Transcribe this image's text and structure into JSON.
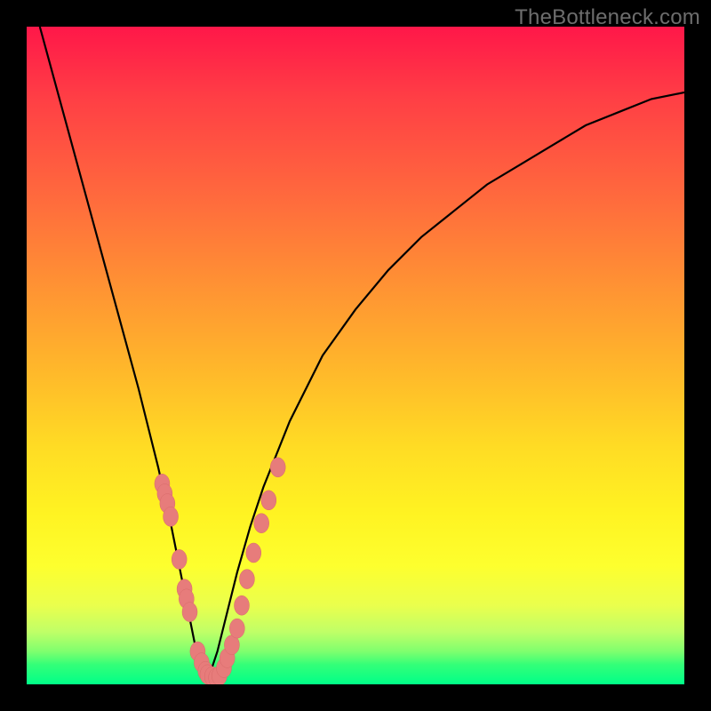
{
  "watermark": "TheBottleneck.com",
  "colors": {
    "frame": "#000000",
    "curve": "#000000",
    "marker_fill": "#e77c7b",
    "marker_stroke": "#d86a69"
  },
  "chart_data": {
    "type": "line",
    "title": "",
    "xlabel": "",
    "ylabel": "",
    "xlim": [
      0,
      100
    ],
    "ylim": [
      0,
      100
    ],
    "grid": false,
    "legend": false,
    "curve": {
      "description": "V-shaped bottleneck curve; minimum (0% bottleneck) near x≈27, rising steeply on both sides",
      "x": [
        2,
        5,
        8,
        11,
        14,
        17,
        20,
        22,
        24,
        25,
        26,
        27,
        28,
        29,
        30,
        32,
        34,
        36,
        40,
        45,
        50,
        55,
        60,
        65,
        70,
        75,
        80,
        85,
        90,
        95,
        100
      ],
      "y": [
        100,
        89,
        78,
        67,
        56,
        45,
        33,
        24,
        14,
        9,
        4,
        1,
        2,
        5,
        9,
        17,
        24,
        30,
        40,
        50,
        57,
        63,
        68,
        72,
        76,
        79,
        82,
        85,
        87,
        89,
        90
      ]
    },
    "series": [
      {
        "name": "left-branch-markers",
        "x": [
          20.6,
          21.0,
          21.4,
          21.9,
          23.2,
          24.0,
          24.3,
          24.8,
          26.0,
          26.6,
          27.2,
          27.5,
          28.2,
          28.8
        ],
        "y": [
          30.5,
          29.0,
          27.5,
          25.5,
          19.0,
          14.5,
          13.0,
          11.0,
          5.0,
          3.3,
          2.0,
          1.5,
          1.2,
          1.0
        ]
      },
      {
        "name": "right-branch-markers",
        "x": [
          29.3,
          30.0,
          30.5,
          31.2,
          32.0,
          32.7,
          33.5,
          34.5,
          35.7,
          36.8,
          38.2
        ],
        "y": [
          1.3,
          2.5,
          4.0,
          6.0,
          8.5,
          12.0,
          16.0,
          20.0,
          24.5,
          28.0,
          33.0
        ]
      }
    ]
  }
}
